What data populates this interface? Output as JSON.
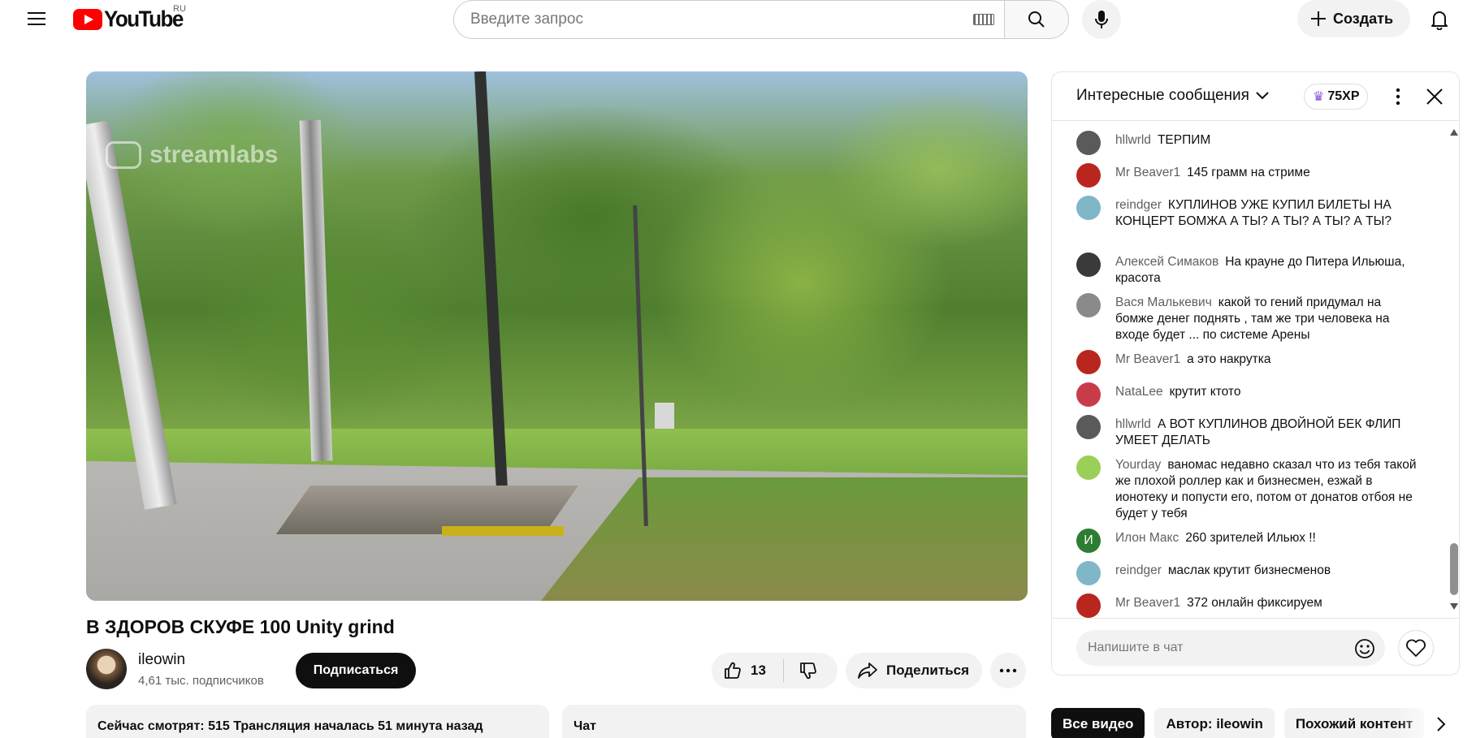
{
  "header": {
    "logo_text": "YouTube",
    "country_code": "RU",
    "search_placeholder": "Введите запрос",
    "create_label": "Создать"
  },
  "video": {
    "watermark": "streamlabs",
    "title": "В ЗДОРОВ СКУФЕ 100 Unity grind",
    "channel_name": "ileowin",
    "subscribers": "4,61 тыс. подписчиков",
    "subscribe_label": "Подписаться",
    "likes": "13",
    "share_label": "Поделиться",
    "watching_text": "Сейчас смотрят: 515  Трансляция началась 51 минута назад",
    "chat_label": "Чат"
  },
  "chat": {
    "mode_label": "Интересные сообщения",
    "xp_label": "75XP",
    "input_placeholder": "Напишите в чат",
    "messages": [
      {
        "author": "hllwrld",
        "text": "ТЕРПИМ",
        "avatar_color": "#5a5a5a"
      },
      {
        "author": "Mr Beaver1",
        "text": "145 грамм на стриме",
        "avatar_color": "#b8261e"
      },
      {
        "author": "reindger",
        "text": "КУПЛИНОВ УЖЕ КУПИЛ БИЛЕТЫ НА КОНЦЕРТ БОМЖА А ТЫ? А ТЫ? А ТЫ? А ТЫ?",
        "avatar_color": "#7fb6c8"
      },
      {
        "author": "Алексей Симаков",
        "text": "На крауне до Питера Ильюша, красота",
        "avatar_color": "#3a3a3a"
      },
      {
        "author": "Вася Малькевич",
        "text": "какой то гений придумал на бомже денег поднять , там же три человека на входе будет ... по системе Арены",
        "avatar_color": "#8a8a8a"
      },
      {
        "author": "Mr Beaver1",
        "text": "а это накрутка",
        "avatar_color": "#b8261e"
      },
      {
        "author": "NataLee",
        "text": "крутит ктото",
        "avatar_color": "#c83c4a"
      },
      {
        "author": "hllwrld",
        "text": "А ВОТ КУПЛИНОВ ДВОЙНОЙ БЕК ФЛИП УМЕЕТ ДЕЛАТЬ",
        "avatar_color": "#5a5a5a"
      },
      {
        "author": "Yourday",
        "text": "ваномас недавно сказал что из тебя такой же плохой роллер как и бизнесмен, езжай в ионотеку и попусти его, потом от донатов отбоя не будет у тебя",
        "avatar_color": "#9ccf5a"
      },
      {
        "author": "Илон Макс",
        "text": "260 зрителей Ильюх !!",
        "avatar_color": "#2f7d32",
        "avatar_letter": "И"
      },
      {
        "author": "reindger",
        "text": "маслак крутит бизнесменов",
        "avatar_color": "#7fb6c8"
      },
      {
        "author": "Mr Beaver1",
        "text": "372 онлайн фиксируем",
        "avatar_color": "#b8261e"
      }
    ]
  },
  "chips": [
    "Все видео",
    "Автор: ileowin",
    "Похожий контент"
  ]
}
